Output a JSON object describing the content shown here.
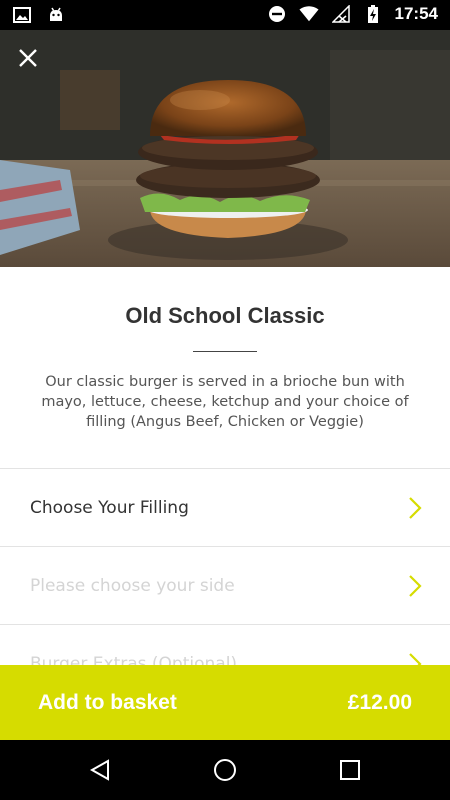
{
  "status_bar": {
    "time": "17:54",
    "icons": [
      "image-icon",
      "android-icon",
      "do-not-disturb-icon",
      "wifi-icon",
      "signal-icon",
      "battery-charging-icon"
    ]
  },
  "hero": {
    "image": "burger-photo"
  },
  "product": {
    "title": "Old School Classic",
    "description": "Our classic burger is served in a brioche bun with mayo, lettuce, cheese, ketchup and your choice of filling (Angus Beef, Chicken or Veggie)"
  },
  "options": [
    {
      "label": "Choose Your Filling",
      "enabled": true
    },
    {
      "label": "Please choose your side",
      "enabled": false
    },
    {
      "label": "Burger Extras (Optional)",
      "enabled": false
    }
  ],
  "basket": {
    "label": "Add to basket",
    "price": "£12.00"
  },
  "colors": {
    "accent": "#d6dc00",
    "text": "#333333",
    "disabled_text": "#d4d4d4"
  }
}
